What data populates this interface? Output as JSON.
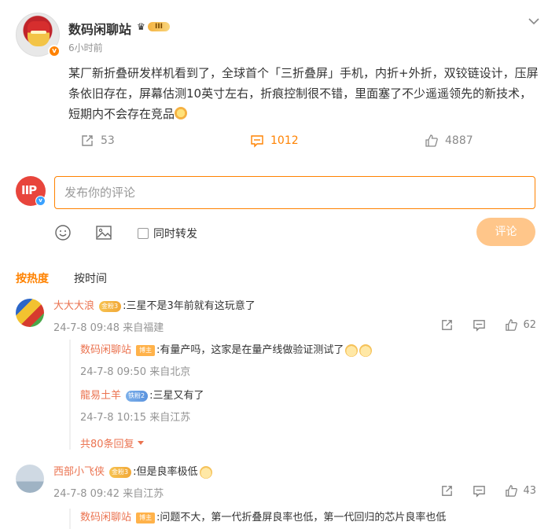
{
  "post": {
    "author": "数码闲聊站",
    "level_badge": "III",
    "time": "6小时前",
    "content": "某厂新折叠研发样机看到了，全球首个「三折叠屏」手机，内折+外折，双铰链设计，压屏条依旧存在，屏幕估测10英寸左右，折痕控制很不错，里面塞了不少遥遥领先的新技术，短期内不会存在竞品",
    "repost_count": "53",
    "comment_count": "1012",
    "like_count": "4887"
  },
  "composer": {
    "placeholder": "发布你的评论",
    "repost_label": "同时转发",
    "submit_label": "评论"
  },
  "sort": {
    "hot": "按热度",
    "time": "按时间"
  },
  "comments": [
    {
      "name": "大大大浪",
      "badge": "金粉3",
      "text": ":三星不是3年前就有这玩意了",
      "meta": "24-7-8 09:48 来自福建",
      "likes": "62",
      "replies": [
        {
          "name": "数码闲聊站",
          "badge": "博主",
          "text": ":有量产吗，这家是在量产线做验证测试了",
          "meta": "24-7-8 09:50 来自北京"
        },
        {
          "name": "龍易土羊",
          "badge": "铁粉2",
          "text": ":三星又有了",
          "meta": "24-7-8 10:15 来自江苏"
        }
      ],
      "more_replies": "共80条回复"
    },
    {
      "name": "西部小飞侠",
      "badge": "金粉3",
      "text": ":但是良率极低",
      "meta": "24-7-8 09:42 来自江苏",
      "likes": "43",
      "replies": [
        {
          "name": "数码闲聊站",
          "badge": "博主",
          "text": ":问题不大，第一代折叠屏良率也低，第一代回归的芯片良率也低"
        }
      ]
    }
  ],
  "colors": {
    "accent": "#ff8200",
    "name": "#eb7350",
    "muted": "#939393"
  }
}
